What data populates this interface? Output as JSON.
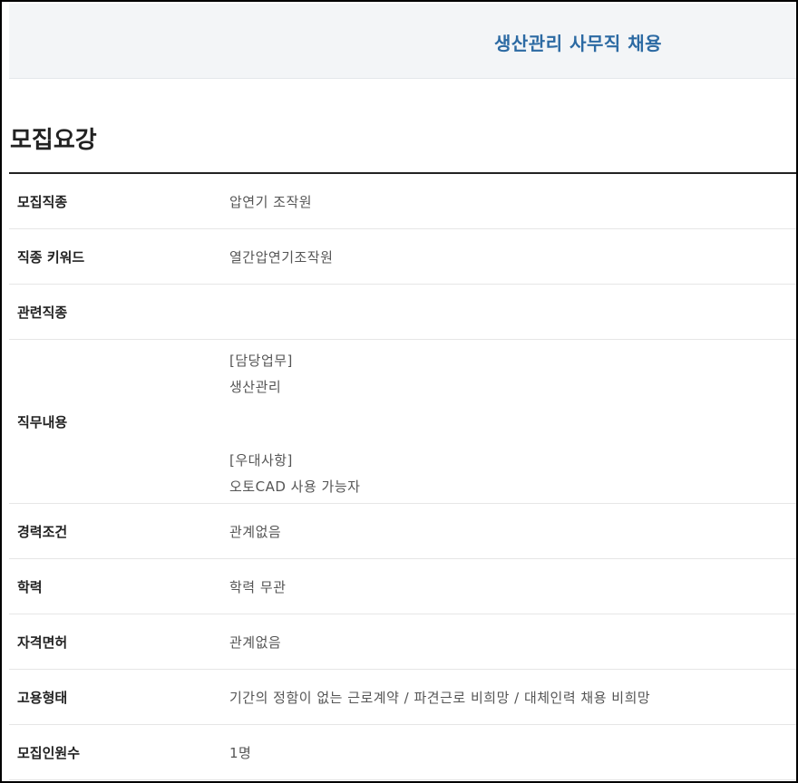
{
  "header": {
    "job_title": "생산관리 사무직 채용"
  },
  "section": {
    "title": "모집요강"
  },
  "rows": [
    {
      "label": "모집직종",
      "value": "압연기 조작원"
    },
    {
      "label": "직종 키워드",
      "value": "열간압연기조작원"
    },
    {
      "label": "관련직종",
      "value": ""
    },
    {
      "label": "직무내용",
      "lines": [
        "[담당업무]",
        "생산관리",
        "[우대사항]",
        "오토CAD  사용 가능자"
      ]
    },
    {
      "label": "경력조건",
      "value": "관계없음"
    },
    {
      "label": "학력",
      "value": "학력 무관"
    },
    {
      "label": "자격면허",
      "value": "관계없음"
    },
    {
      "label": "고용형태",
      "value": "기간의 정함이 없는 근로계약 / 파견근로 비희망 / 대체인력 채용 비희망"
    },
    {
      "label": "모집인원수",
      "value": "1명"
    }
  ]
}
